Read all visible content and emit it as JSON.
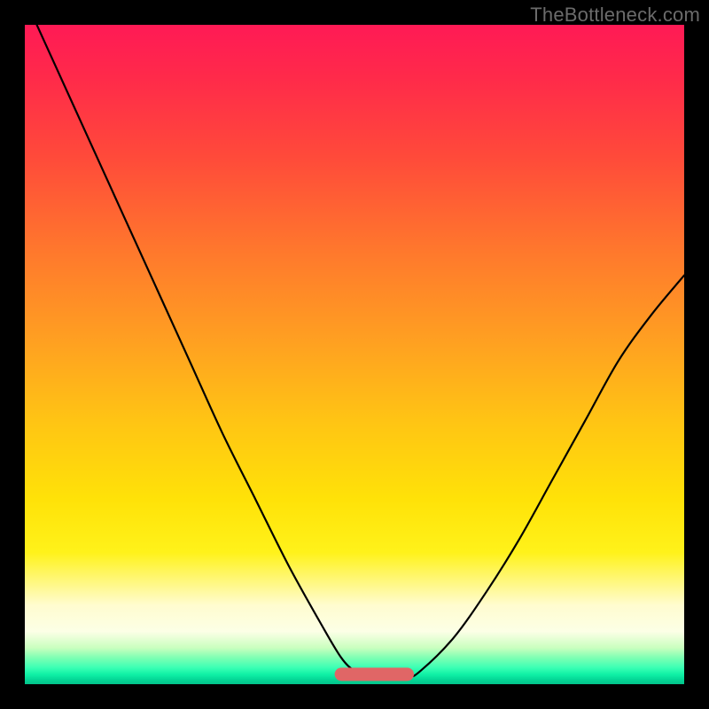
{
  "watermark": "TheBottleneck.com",
  "colors": {
    "frame": "#000000",
    "curve": "#000000",
    "flat_segment": "#e06666",
    "gradient_stops": [
      "#ff1a55",
      "#ff7a2c",
      "#ffe208",
      "#fffccf",
      "#10f2a6",
      "#03c38a"
    ]
  },
  "chart_data": {
    "type": "line",
    "title": "",
    "xlabel": "",
    "ylabel": "",
    "xlim": [
      0,
      100
    ],
    "ylim": [
      0,
      100
    ],
    "x": [
      0,
      5,
      10,
      15,
      20,
      25,
      30,
      35,
      40,
      45,
      48,
      50,
      52,
      55,
      58,
      60,
      65,
      70,
      75,
      80,
      85,
      90,
      95,
      100
    ],
    "values": [
      104,
      93,
      82,
      71,
      60,
      49,
      38,
      28,
      18,
      9,
      4,
      2,
      1,
      1,
      1,
      2,
      7,
      14,
      22,
      31,
      40,
      49,
      56,
      62
    ],
    "flat_region_x": [
      48,
      58
    ],
    "flat_region_y": 1.5,
    "annotations": []
  }
}
